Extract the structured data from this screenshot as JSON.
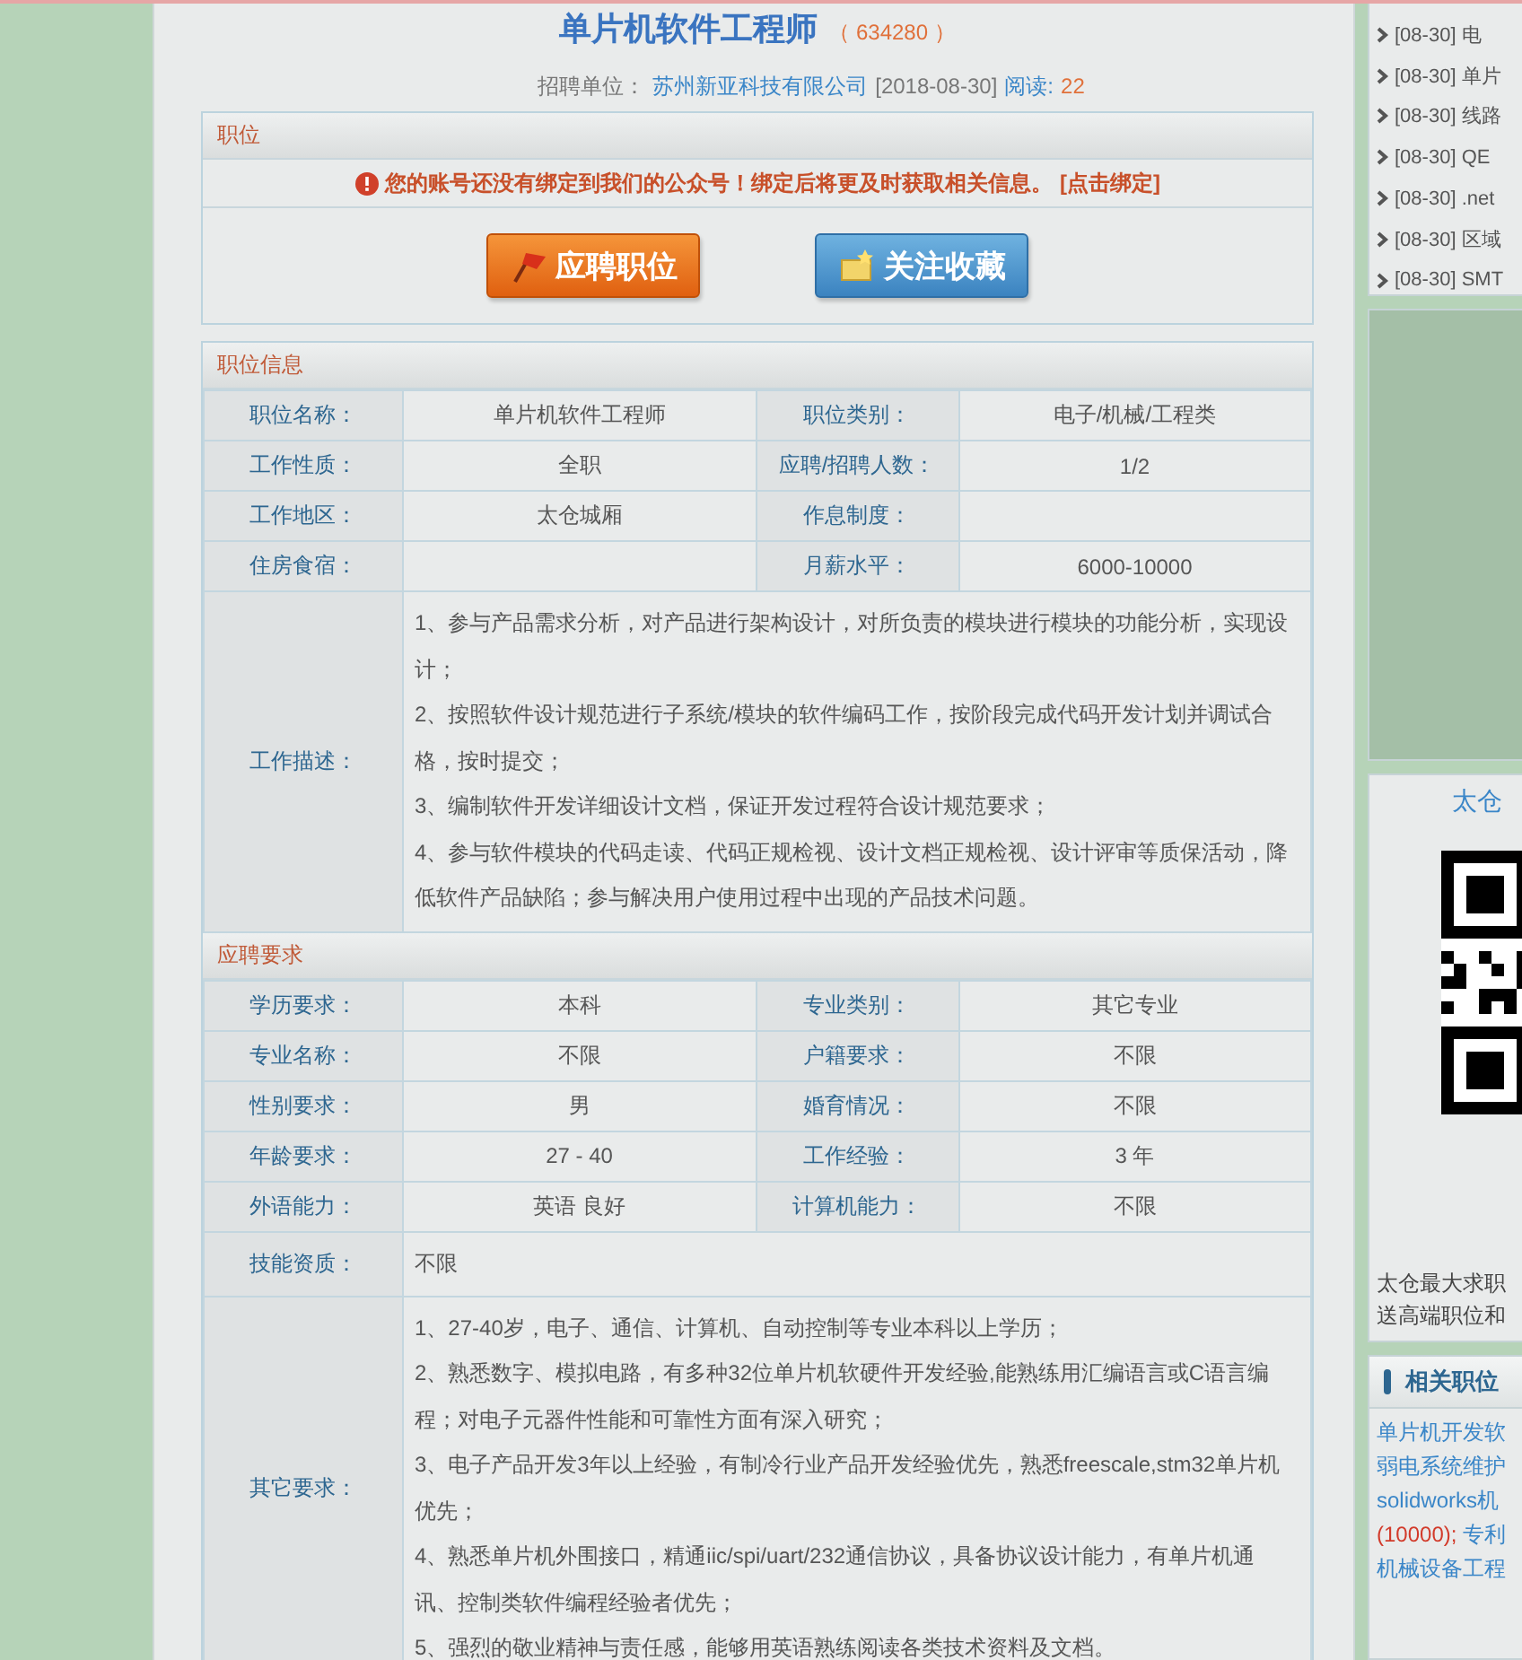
{
  "job": {
    "title": "单片机软件工程师",
    "code": "（ 634280 ）",
    "company_label": "招聘单位：",
    "company": "苏州新亚科技有限公司",
    "date": "[2018-08-30]",
    "views_label": "阅读:",
    "views": "22"
  },
  "ops": {
    "header": "职位",
    "notice": "您的账号还没有绑定到我们的公众号！绑定后将更及时获取相关信息。",
    "bind_link": "[点击绑定]",
    "buttons": [
      {
        "label": "应聘职位",
        "kind": "apply"
      },
      {
        "label": "关注收藏",
        "kind": "follow"
      }
    ]
  },
  "info": {
    "header": "职位信息",
    "rows": [
      [
        "职位名称：",
        "单片机软件工程师",
        "职位类别：",
        "电子/机械/工程类"
      ],
      [
        "工作性质：",
        "全职",
        "应聘/招聘人数：",
        "1/2"
      ],
      [
        "工作地区：",
        "太仓城厢",
        "作息制度：",
        ""
      ],
      [
        "住房食宿：",
        "",
        "月薪水平：",
        "6000-10000"
      ]
    ],
    "description": {
      "label": "工作描述：",
      "lines": [
        "1、参与产品需求分析，对产品进行架构设计，对所负责的模块进行模块的功能分析，实现设计；",
        "2、按照软件设计规范进行子系统/模块的软件编码工作，按阶段完成代码开发计划并调试合格，按时提交；",
        "3、编制软件开发详细设计文档，保证开发过程符合设计规范要求；",
        "4、参与软件模块的代码走读、代码正规检视、设计文档正规检视、设计评审等质保活动，降低软件产品缺陷；参与解决用户使用过程中出现的产品技术问题。"
      ]
    }
  },
  "requirements": {
    "header": "应聘要求",
    "rows": [
      [
        "学历要求：",
        "本科",
        "专业类别：",
        "其它专业"
      ],
      [
        "专业名称：",
        "不限",
        "户籍要求：",
        "不限"
      ],
      [
        "性别要求：",
        "男",
        "婚育情况：",
        "不限"
      ],
      [
        "年龄要求：",
        "27 - 40",
        "工作经验：",
        "3 年"
      ],
      [
        "外语能力：",
        "英语 良好",
        "计算机能力：",
        "不限"
      ]
    ],
    "skills": {
      "label": "技能资质：",
      "value": "不限"
    },
    "other": {
      "label": "其它要求：",
      "lines": [
        "1、27-40岁，电子、通信、计算机、自动控制等专业本科以上学历；",
        "2、熟悉数字、模拟电路，有多种32位单片机软硬件开发经验,能熟练用汇编语言或C语言编程；对电子元器件性能和可靠性方面有深入研究；",
        "3、电子产品开发3年以上经验，有制冷行业产品开发经验优先，熟悉freescale,stm32单片机优先；",
        "4、熟悉单片机外围接口，精通iic/spi/uart/232通信协议，具备协议设计能力，有单片机通讯、控制类软件编程经验者优先；",
        "5、强烈的敬业精神与责任感，能够用英语熟练阅读各类技术资料及文档。"
      ]
    }
  },
  "sidebar": {
    "recent": [
      {
        "date": "[08-30]",
        "title": "电"
      },
      {
        "date": "[08-30]",
        "title": "单片"
      },
      {
        "date": "[08-30]",
        "title": "线路"
      },
      {
        "date": "[08-30]",
        "title": "QE"
      },
      {
        "date": "[08-30]",
        "title": ".net"
      },
      {
        "date": "[08-30]",
        "title": "区域"
      },
      {
        "date": "[08-30]",
        "title": "SMT"
      }
    ],
    "qr": {
      "title": "太仓",
      "caption_lines": [
        "太仓最大求职",
        "送高端职位和"
      ]
    },
    "related": {
      "header": "相关职位",
      "lines": [
        [
          {
            "text": "单片机开发软",
            "kind": "link"
          }
        ],
        [
          {
            "text": "弱电系统维护",
            "kind": "link"
          }
        ],
        [
          {
            "text": "solidworks机",
            "kind": "link"
          }
        ],
        [
          {
            "text": "(10000);",
            "kind": "salary"
          },
          {
            "text": " 专利",
            "kind": "link"
          }
        ],
        [
          {
            "text": "机械设备工程",
            "kind": "link"
          }
        ]
      ]
    }
  }
}
